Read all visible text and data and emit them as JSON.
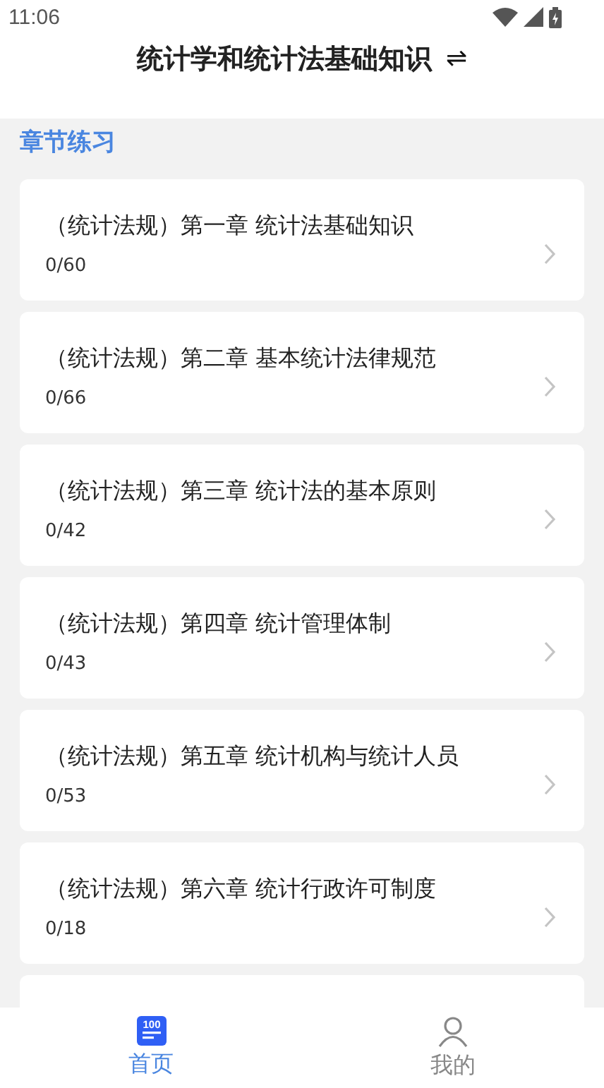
{
  "status_bar": {
    "time": "11:06"
  },
  "header": {
    "title": "统计学和统计法基础知识",
    "switch_icon": "⇌"
  },
  "section_title": "章节练习",
  "chapters": [
    {
      "title": "（统计法规）第一章 统计法基础知识",
      "progress": "0/60"
    },
    {
      "title": "（统计法规）第二章 基本统计法律规范",
      "progress": "0/66"
    },
    {
      "title": "（统计法规）第三章 统计法的基本原则",
      "progress": "0/42"
    },
    {
      "title": "（统计法规）第四章 统计管理体制",
      "progress": "0/43"
    },
    {
      "title": "（统计法规）第五章 统计机构与统计人员",
      "progress": "0/53"
    },
    {
      "title": "（统计法规）第六章 统计行政许可制度",
      "progress": "0/18"
    }
  ],
  "more_cards_below": true,
  "tab_bar": [
    {
      "label": "首页",
      "kind": "home",
      "icon_text": "100",
      "selected": true
    },
    {
      "label": "我的",
      "kind": "profile",
      "selected": false
    }
  ]
}
